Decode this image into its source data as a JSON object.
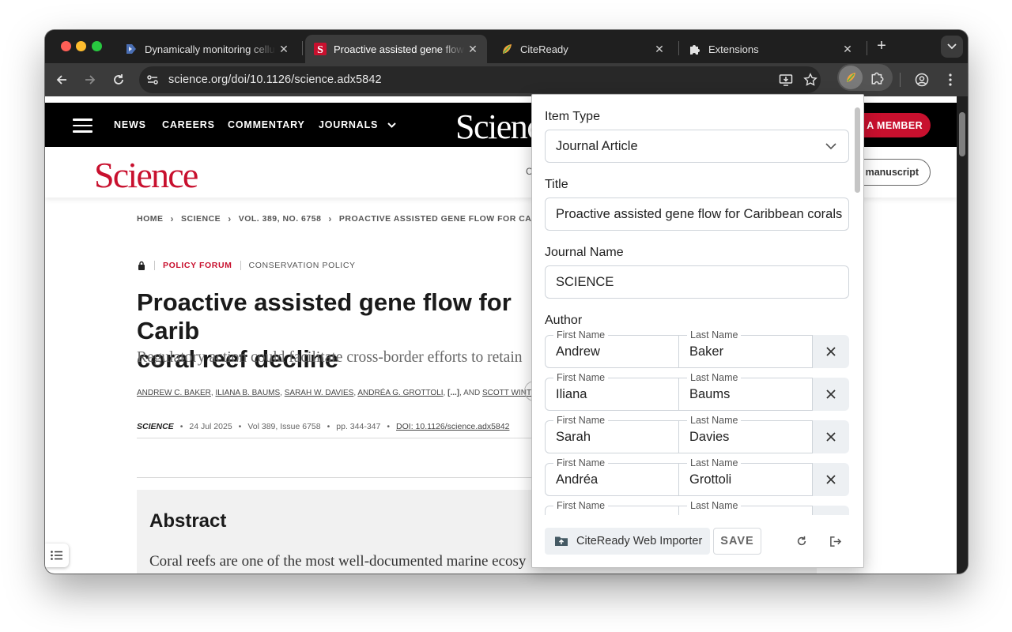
{
  "browser": {
    "tabs": [
      {
        "title": "Dynamically monitoring cellul",
        "favicon": "document-play-icon"
      },
      {
        "title": "Proactive assisted gene flow f",
        "favicon": "science-s-icon",
        "active": true
      },
      {
        "title": "CiteReady",
        "favicon": "citeready-leaf-icon"
      },
      {
        "title": "Extensions",
        "favicon": "puzzle-icon"
      }
    ],
    "url": "science.org/doi/10.1126/science.adx5842"
  },
  "site": {
    "nav": [
      "NEWS",
      "CAREERS",
      "COMMENTARY",
      "JOURNALS"
    ],
    "logo": "Science",
    "member_button": "A MEMBER",
    "header_partial": "C",
    "manuscript_button": "manuscript"
  },
  "article": {
    "breadcrumb": [
      "HOME",
      "SCIENCE",
      "VOL. 389, NO. 6758",
      "PROACTIVE ASSISTED GENE FLOW FOR CARIBBEAN COR"
    ],
    "section": "POLICY FORUM",
    "category": "CONSERVATION POLICY",
    "title_line1": "Proactive assisted gene flow for Carib",
    "title_line2": "coral reef decline",
    "subtitle": "Regulatory action could facilitate cross-border efforts to retain",
    "authors": [
      "ANDREW C. BAKER",
      "ILIANA B. BAUMS",
      "SARAH W. DAVIES",
      "ANDRÉA G. GROTTOLI"
    ],
    "authors_more": "[...]",
    "authors_and": ", AND",
    "last_author": "SCOTT WINTERS",
    "journal": "SCIENCE",
    "date": "24 Jul 2025",
    "volume": "Vol 389, Issue 6758",
    "pages": "pp. 344-347",
    "doi": "DOI: 10.1126/science.adx5842",
    "abstract_heading": "Abstract",
    "abstract_text": "Coral reefs are one of the most well-documented marine ecosy"
  },
  "popup": {
    "item_type_label": "Item Type",
    "item_type_value": "Journal Article",
    "title_label": "Title",
    "title_value": "Proactive assisted gene flow for Caribbean corals",
    "journal_label": "Journal Name",
    "journal_value": "SCIENCE",
    "author_label": "Author",
    "first_name_label": "First Name",
    "last_name_label": "Last Name",
    "authors": [
      {
        "first": "Andrew",
        "last": "Baker"
      },
      {
        "first": "Iliana",
        "last": "Baums"
      },
      {
        "first": "Sarah",
        "last": "Davies"
      },
      {
        "first": "Andréa",
        "last": "Grottoli"
      },
      {
        "first": "",
        "last": ""
      }
    ],
    "importer_button": "CiteReady Web Importer",
    "save_button": "SAVE"
  },
  "colors": {
    "science_red": "#c8102e",
    "chrome_dark": "#1f1f1f",
    "chrome_toolbar": "#3b3b3b"
  }
}
